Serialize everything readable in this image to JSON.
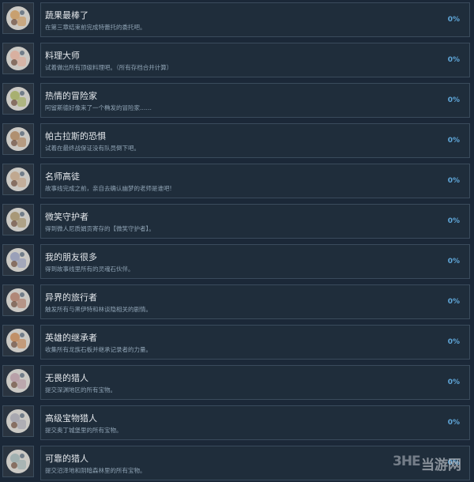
{
  "achievements": [
    {
      "title": "蔬果最棒了",
      "desc": "在第三章结束前完成特蕾托的委托吧。",
      "percent": "0%",
      "icon": "vegetable-basket-icon",
      "accent": "#c8a070"
    },
    {
      "title": "料理大师",
      "desc": "试着做出所有顶级料理吧。（所有存档合并计算）",
      "percent": "0%",
      "icon": "cooking-dish-icon",
      "accent": "#d8b0a0"
    },
    {
      "title": "热情的冒险家",
      "desc": "阿留斯德好像来了一个椭发的冒险家……",
      "percent": "0%",
      "icon": "adventurer-map-icon",
      "accent": "#a8b070"
    },
    {
      "title": "帕古拉斯的恐惧",
      "desc": "试着在最终战保证没有队员倒下吧。",
      "percent": "0%",
      "icon": "knight-portrait-icon",
      "accent": "#b09070"
    },
    {
      "title": "名师高徒",
      "desc": "故事线完成之前，亲自去确认幽梦的老师是谁吧!",
      "percent": "0%",
      "icon": "teacher-student-icon",
      "accent": "#c0a890"
    },
    {
      "title": "微笑守护者",
      "desc": "得到微人尼质娟贡寄存的【微笑守护者】。",
      "percent": "0%",
      "icon": "smile-guardian-icon",
      "accent": "#a89878"
    },
    {
      "title": "我的朋友很多",
      "desc": "得到故事线里所有的灵魂石伙伴。",
      "percent": "0%",
      "icon": "friends-group-icon",
      "accent": "#9aa0b8"
    },
    {
      "title": "异界的旅行者",
      "desc": "触发所有与黑伊特和林谈隐相关的剧情。",
      "percent": "0%",
      "icon": "otherworld-traveler-icon",
      "accent": "#b08878"
    },
    {
      "title": "英雄的继承者",
      "desc": "收集所有龙族石板并继承记录者的力量。",
      "percent": "0%",
      "icon": "hero-heir-icon",
      "accent": "#c09068"
    },
    {
      "title": "无畏的猎人",
      "desc": "提交深渊地区的所有宝物。",
      "percent": "0%",
      "icon": "hunter-emblem-icon",
      "accent": "#b8a0a8"
    },
    {
      "title": "高级宝物猎人",
      "desc": "提交奥丁城堡里的所有宝物。",
      "percent": "0%",
      "icon": "treasure-emblem-icon",
      "accent": "#a8a8b0"
    },
    {
      "title": "可靠的猎人",
      "desc": "提交沼泽地和阴暗森林里的所有宝物。",
      "percent": "0%",
      "icon": "reliable-hunter-icon",
      "accent": "#a0b0b0"
    }
  ],
  "watermark": {
    "mark": "3HE",
    "text": "当游网"
  }
}
